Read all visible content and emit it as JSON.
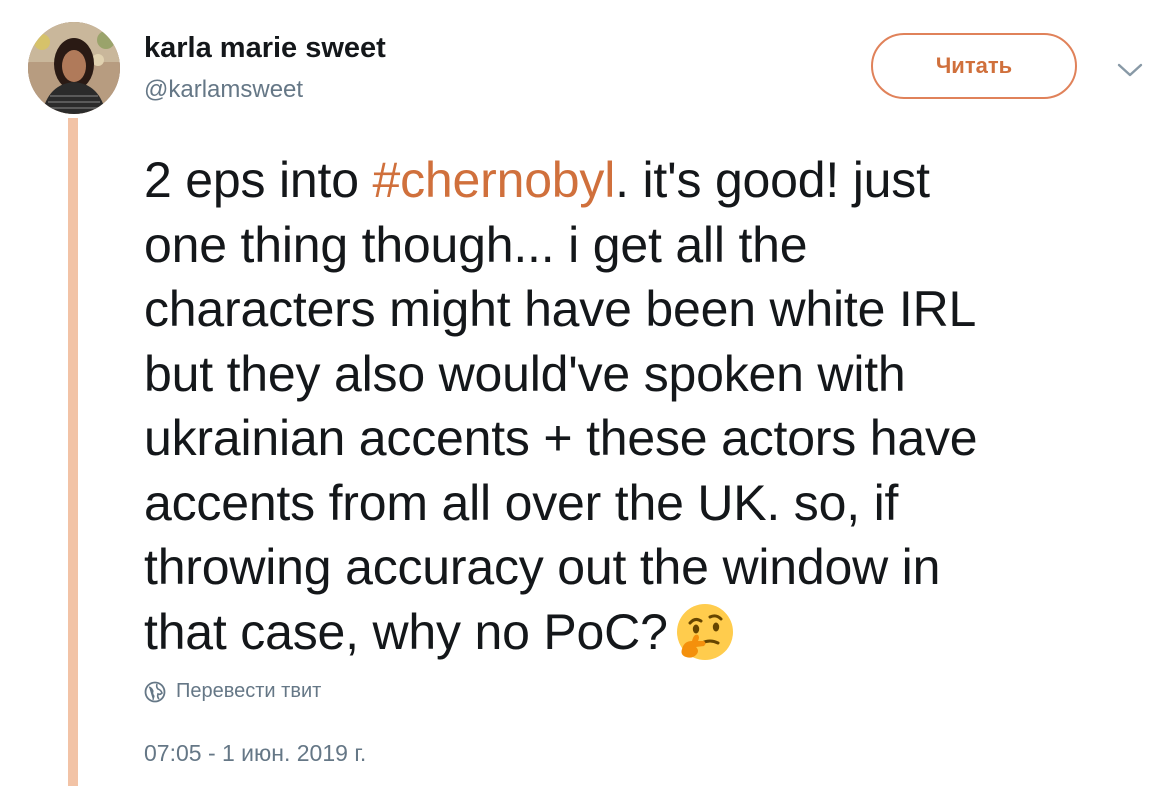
{
  "author": {
    "display_name": "karla marie sweet",
    "handle": "@karlamsweet"
  },
  "header": {
    "follow_label": "Читать"
  },
  "tweet": {
    "lines": [
      {
        "before": "2 eps into ",
        "hashtag": "#chernobyl",
        "after": ". it's good! just"
      },
      {
        "text": "one thing though... i get all the"
      },
      {
        "text": "characters might have been white IRL"
      },
      {
        "text": "but they also would've spoken with"
      },
      {
        "text": "ukrainian accents + these actors have"
      },
      {
        "text": "accents from all over the UK. so, if"
      },
      {
        "text": "throwing accuracy out the window in"
      },
      {
        "text": "that case, why no PoC?",
        "emoji": "thinking-face-icon"
      }
    ]
  },
  "translate_label": "Перевести твит",
  "timestamp": "07:05 - 1 июн. 2019 г.",
  "colors": {
    "accent": "#d0703c",
    "thread_line": "#f2c3a6",
    "secondary_text": "#657786"
  }
}
